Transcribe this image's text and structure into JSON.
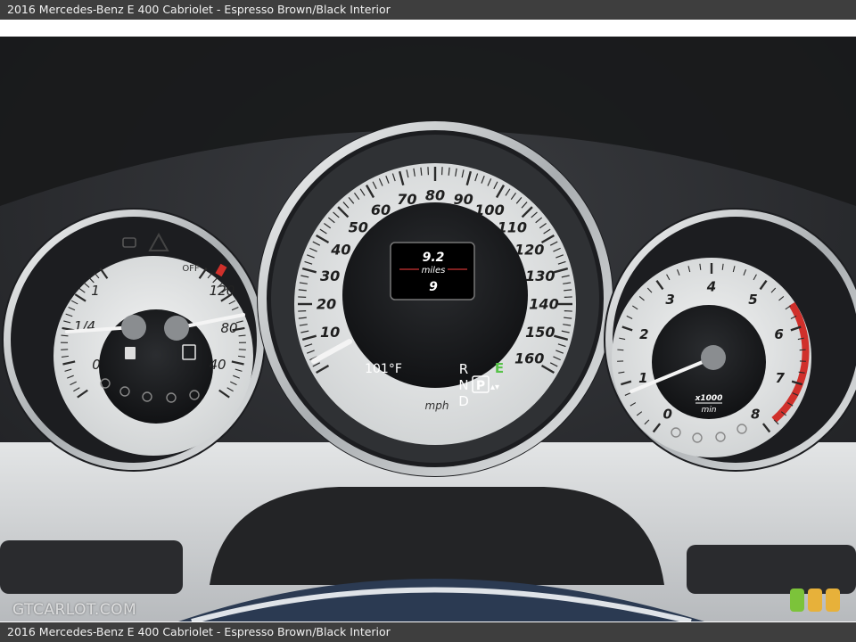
{
  "caption": {
    "top": "2016 Mercedes-Benz E 400 Cabriolet - Espresso Brown/Black Interior",
    "bottom": "2016 Mercedes-Benz E 400 Cabriolet - Espresso Brown/Black Interior"
  },
  "watermark": "GTCARLOT.COM",
  "speedometer": {
    "labels": [
      "10",
      "20",
      "30",
      "40",
      "50",
      "60",
      "70",
      "80",
      "90",
      "100",
      "110",
      "120",
      "130",
      "140",
      "150",
      "160"
    ],
    "unit": "mph",
    "trip_value": "9.2",
    "trip_unit": "miles",
    "trip_second": "9",
    "temperature": "101°F",
    "gear_r": "R",
    "gear_n": "N",
    "gear_p": "P",
    "gear_d": "D",
    "gear_e": "E"
  },
  "tachometer": {
    "labels": [
      "0",
      "1",
      "2",
      "3",
      "4",
      "5",
      "6",
      "7",
      "8"
    ],
    "unit_top": "x1000",
    "unit_bottom": "min"
  },
  "left_gauge": {
    "fuel_labels": [
      "0",
      "1/4",
      "1"
    ],
    "temp_labels": [
      "40",
      "80",
      "120"
    ],
    "off_label": "OFF"
  },
  "colors": {
    "dial_face": "#e4e6e6",
    "dial_center": "#1b1c1e",
    "bezel": "#c9cbcd",
    "needle": "#ffffff",
    "redline": "#d0302b",
    "eco_green": "#58c24a",
    "dash": "#2e3033",
    "trim": "#cfd1d3"
  }
}
